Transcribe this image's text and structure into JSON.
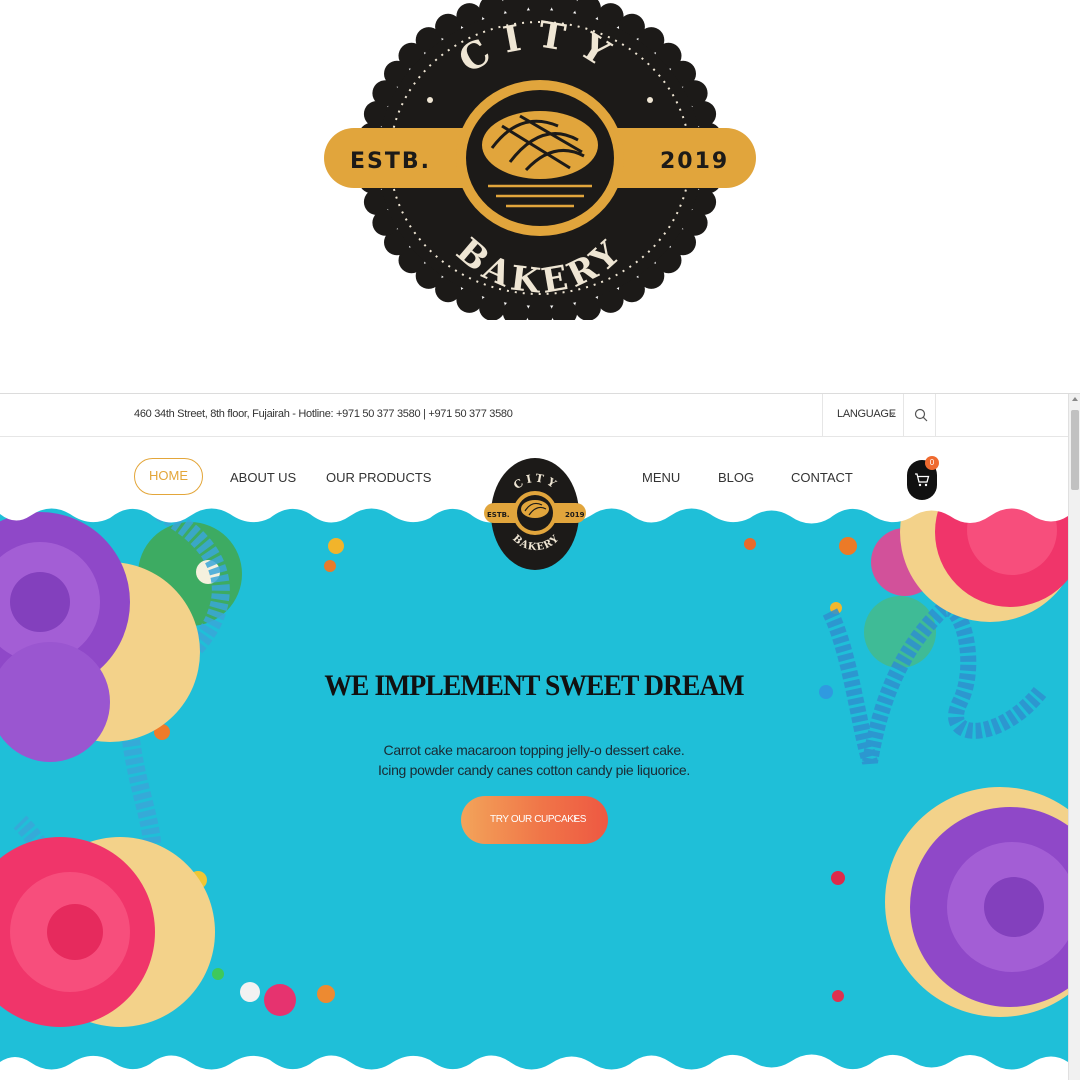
{
  "logo": {
    "top_text": "CITY",
    "bottom_text": "BAKERY",
    "left_text": "ESTB.",
    "right_text": "2019",
    "colors": {
      "dark": "#1c1a18",
      "gold": "#e1a53c",
      "cream": "#efe6d4"
    }
  },
  "topbar": {
    "address": "460 34th Street, 8th floor, Fujairah - Hotline: +971 50 377 3580  |  +971 50 377 3580",
    "language_label": "LANGUAGE",
    "language_chevron": "⌄",
    "search_icon": "search-icon"
  },
  "nav": {
    "home": "HOME",
    "about": "ABOUT US",
    "products": "OUR PRODUCTS",
    "menu": "MENU",
    "blog": "BLOG",
    "contact": "CONTACT",
    "cart_count": "0",
    "cart_icon": "cart-icon"
  },
  "hero": {
    "title": "WE IMPLEMENT SWEET DREAM",
    "subtitle_line1": "Carrot cake macaroon topping jelly-o dessert cake.",
    "subtitle_line2": "Icing powder candy canes cotton candy pie liquorice.",
    "cta_label": "TRY OUR CUPCAKES",
    "cta_arrow": "›",
    "colors": {
      "background": "#1fbfd8",
      "accent": "#e3a63a",
      "cta_start": "#f3a45a",
      "cta_end": "#ee5842"
    }
  }
}
